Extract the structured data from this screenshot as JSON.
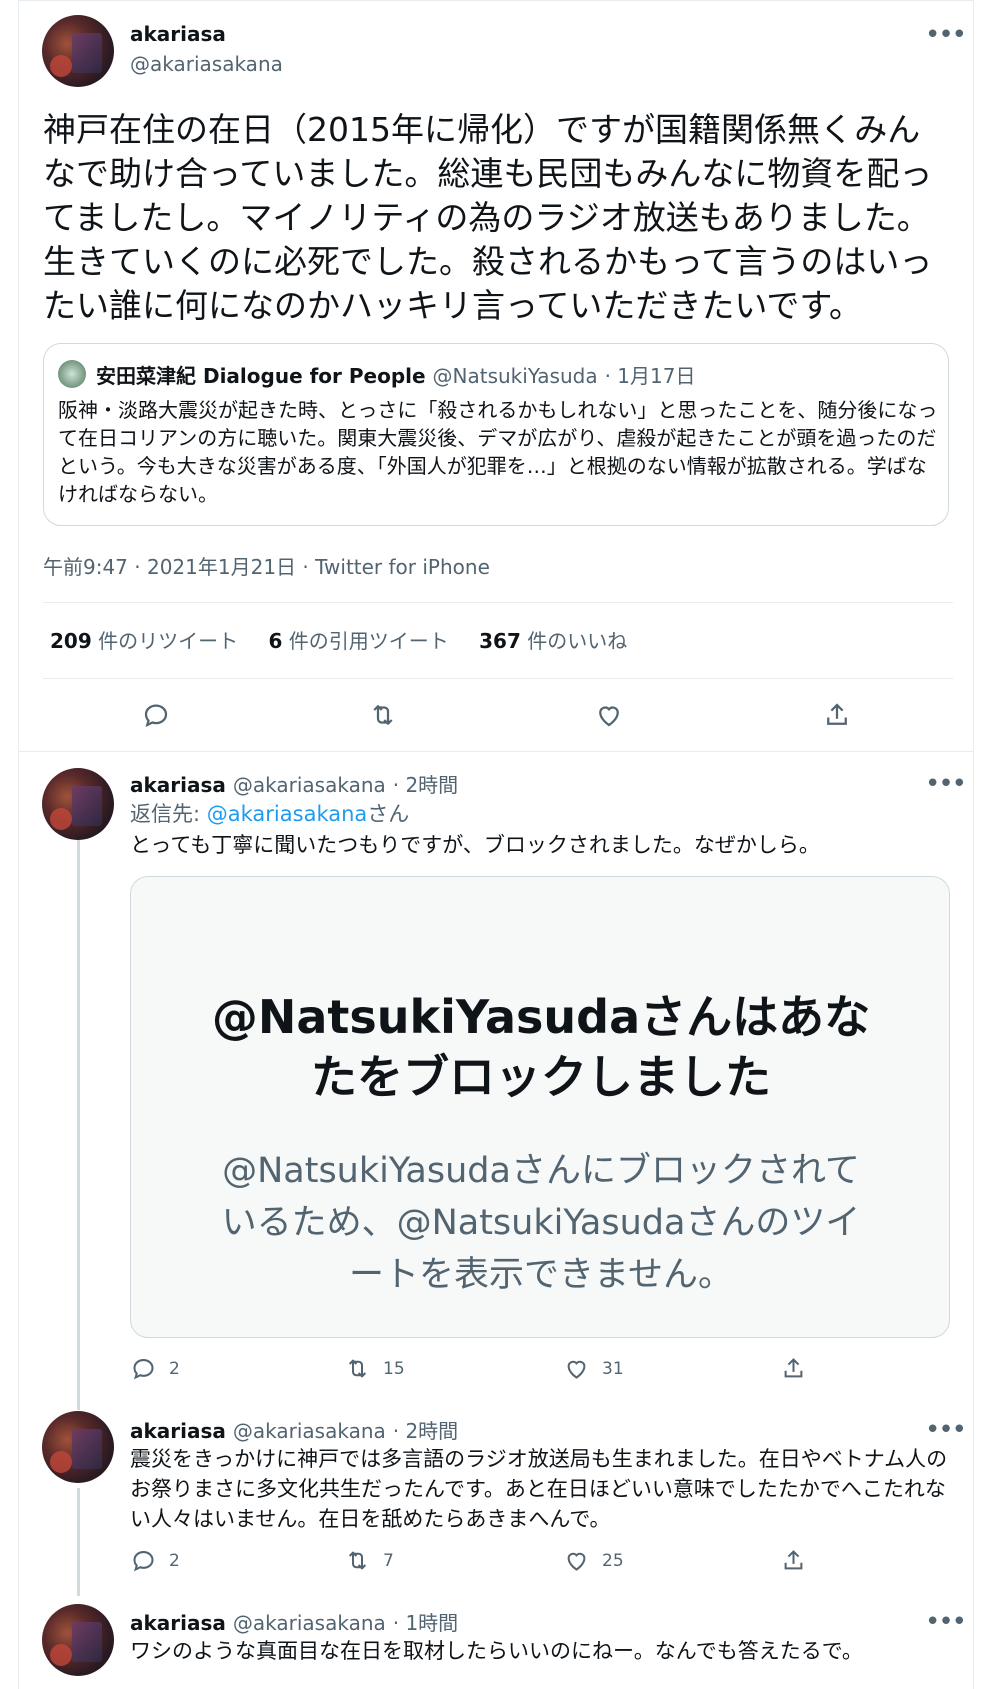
{
  "main_tweet": {
    "name": "akariasa",
    "handle": "@akariasakana",
    "text": "神戸在住の在日（2015年に帰化）ですが国籍関係無くみんなで助け合っていました。総連も民団もみんなに物資を配ってましたし。マイノリティの為のラジオ放送もありました。生きていくのに必死でした。殺されるかもって言うのはいったい誰に何になのかハッキリ言っていただきたいです。",
    "quote": {
      "name": "安田菜津紀 Dialogue for People",
      "handle": "@NatsukiYasuda",
      "date": "· 1月17日",
      "text": "阪神・淡路大震災が起きた時、とっさに「殺されるかもしれない」と思ったことを、随分後になって在日コリアンの方に聴いた。関東大震災後、デマが広がり、虐殺が起きたことが頭を過ったのだという。今も大きな災害がある度、「外国人が犯罪を…」と根拠のない情報が拡散される。学ばなければならない。"
    },
    "meta": "午前9:47 · 2021年1月21日 · Twitter for iPhone",
    "stats": {
      "retweets_count": "209",
      "retweets_label": "件のリツイート",
      "quotes_count": "6",
      "quotes_label": "件の引用ツイート",
      "likes_count": "367",
      "likes_label": "件のいいね"
    }
  },
  "replies": [
    {
      "name": "akariasa",
      "handle": "@akariasakana",
      "time": "· 2時間",
      "reply_to_prefix": "返信先: ",
      "reply_to_handle": "@akariasakana",
      "reply_to_suffix": "さん",
      "text": "とっても丁寧に聞いたつもりですが、ブロックされました。なぜかしら。",
      "blocked_title": "@NatsukiYasudaさんはあなたをブロックしました",
      "blocked_sub": "@NatsukiYasudaさんにブロックされているため、@NatsukiYasudaさんのツイートを表示できません。",
      "replies": "2",
      "retweets": "15",
      "likes": "31"
    },
    {
      "name": "akariasa",
      "handle": "@akariasakana",
      "time": "· 2時間",
      "text": "震災をきっかけに神戸では多言語のラジオ放送局も生まれました。在日やベトナム人のお祭りまさに多文化共生だったんです。あと在日ほどいい意味でしたたかでへこたれない人々はいません。在日を舐めたらあきまへんで。",
      "replies": "2",
      "retweets": "7",
      "likes": "25"
    },
    {
      "name": "akariasa",
      "handle": "@akariasakana",
      "time": "· 1時間",
      "text": "ワシのような真面目な在日を取材したらいいのにねー。なんでも答えたるで。"
    }
  ],
  "icons": {
    "more": "more-dots-icon",
    "reply": "reply-bubble-icon",
    "retweet": "retweet-icon",
    "like": "heart-icon",
    "share": "share-icon"
  }
}
